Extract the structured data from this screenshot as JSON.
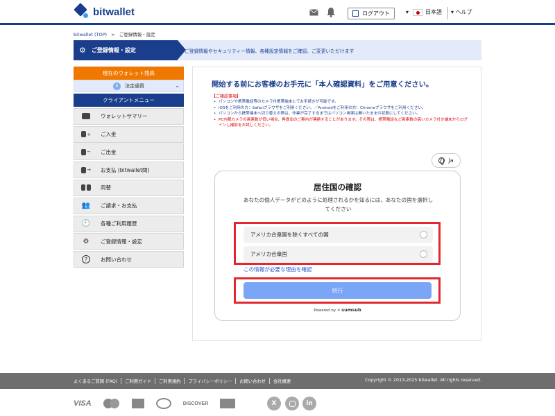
{
  "header": {
    "logo_text": "bitwallet",
    "logout_label": "ログアウト",
    "language_label": "日本語",
    "help_label": "ヘルプ"
  },
  "breadcrumb": {
    "home": "bitwallet (TOP)",
    "separator": ">",
    "current": "ご登録情報・設定"
  },
  "banner": {
    "title": "ご登録情報・設定",
    "description": "ご登録情報やセキュリティー情報、各種設定情報をご確認、ご変更いただけます"
  },
  "sidebar": {
    "wallet_header": "現在のウォレット残高",
    "currency_label": "法定通貨",
    "client_menu_header": "クライアントメニュー",
    "items": [
      {
        "label": "ウォレットサマリー",
        "icon": "wallet-icon"
      },
      {
        "label": "ご入金",
        "icon": "deposit-icon"
      },
      {
        "label": "ご出金",
        "icon": "withdraw-icon"
      },
      {
        "label": "お支払 (bitwallet間)",
        "icon": "transfer-icon"
      },
      {
        "label": "両替",
        "icon": "exchange-icon"
      },
      {
        "label": "ご請求・お支払",
        "icon": "invoice-icon"
      },
      {
        "label": "各種ご利用履歴",
        "icon": "history-icon"
      },
      {
        "label": "ご登録情報・設定",
        "icon": "gear-icon"
      },
      {
        "label": "お問い合わせ",
        "icon": "help-circle-icon"
      }
    ]
  },
  "main": {
    "title": "開始する前にお客様のお手元に「本人確認資料」をご用意ください。",
    "notes_header": "【ご確認事項】",
    "notes": [
      {
        "text": "パソコンや携帯電話等のカメラ付携帯端末にてお手続きが可能です。",
        "color": "blue"
      },
      {
        "text": "iOSをご利用の方：Safariブラウザをご利用ください。／Androidをご利用の方：Chromeブラウザをご利用ください。",
        "color": "blue"
      },
      {
        "text": "パソコンから携帯端末へ切り替えの際は、作業が完了するまではパソコン画面は開いたままの状態にしてください。",
        "color": "blue"
      },
      {
        "text": "PC内蔵カメラの画素数が低い場合、再提出のご案内が連絡することがあります。その際は、携帯電話など画素数の高いカメラ付き端末からログインし撮影をお試しください。",
        "color": "red"
      }
    ],
    "lang_button": "Ja"
  },
  "card": {
    "title": "居住国の確認",
    "subtitle": "あなたの個人データがどのように処理されるかを知るには、あなたの国を選択してください",
    "options": [
      "アメリカ合衆国を除くすべての国",
      "アメリカ合衆国"
    ],
    "why_link": "この情報が必要な理由を確認",
    "continue_label": "続行",
    "powered_prefix": "Powered by",
    "powered_brand": "sumsub"
  },
  "footer": {
    "links": [
      "よくあるご質問 (FAQ)",
      "ご利用ガイド",
      "ご利用規約",
      "プライバシーポリシー",
      "お問い合わせ",
      "会社概要"
    ],
    "copyright": "Copyright © 2013-2025 bitwallet. All rights reserved.",
    "payment_brands": [
      "VISA",
      "DISCOVER"
    ],
    "social": [
      "X",
      "in"
    ]
  },
  "colors": {
    "brand_navy": "#1a3e8c",
    "accent_orange": "#f07800",
    "highlight_red": "#e0282e",
    "button_blue": "#7aa6f5"
  }
}
